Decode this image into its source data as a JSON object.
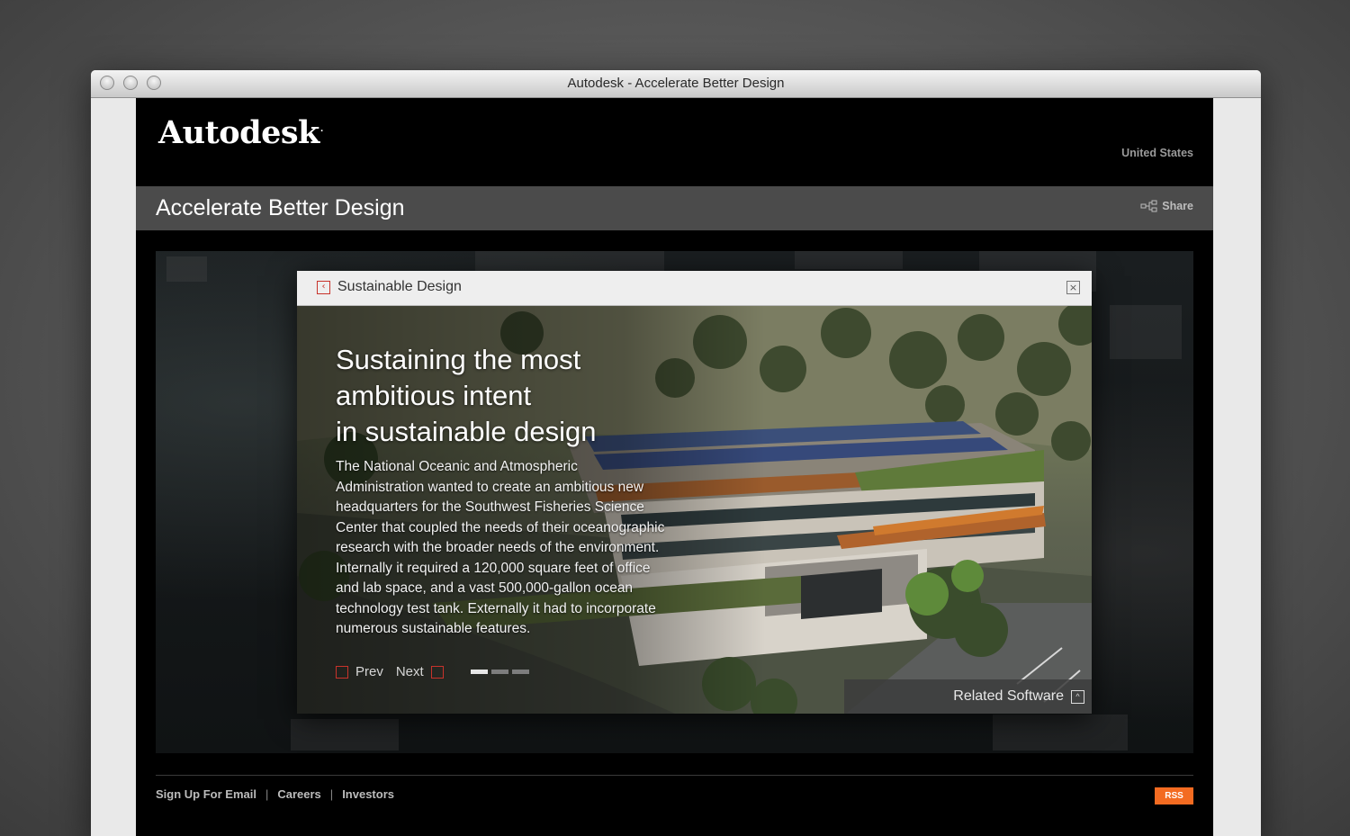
{
  "window": {
    "title": "Autodesk - Accelerate Better Design"
  },
  "header": {
    "logo": "Autodesk",
    "logo_mark": ".",
    "region": "United States"
  },
  "pagebar": {
    "title": "Accelerate Better Design",
    "share_label": "Share"
  },
  "modal": {
    "title": "Sustainable Design",
    "headline_lines": [
      "Sustaining the most",
      "ambitious intent",
      "in sustainable design"
    ],
    "body_lines": [
      "The National Oceanic and Atmospheric",
      "Administration wanted to create an ambitious new",
      "headquarters for the Southwest Fisheries Science",
      "Center that coupled the needs of their oceanographic",
      "research with the broader needs of the environment.",
      "Internally it required a 120,000 square feet of office",
      "and lab space, and a vast 500,000-gallon ocean",
      "technology test tank. Externally it had to incorporate",
      "numerous sustainable features."
    ],
    "prev_label": "Prev",
    "next_label": "Next",
    "slides_total": 3,
    "slide_active": 1,
    "related_label": "Related Software"
  },
  "footer": {
    "links": [
      "Sign Up For Email",
      "Careers",
      "Investors"
    ],
    "separator": "|",
    "rss_label": "RSS"
  },
  "colors": {
    "accent_red": "#c8332b",
    "rss_orange": "#f36b21"
  }
}
